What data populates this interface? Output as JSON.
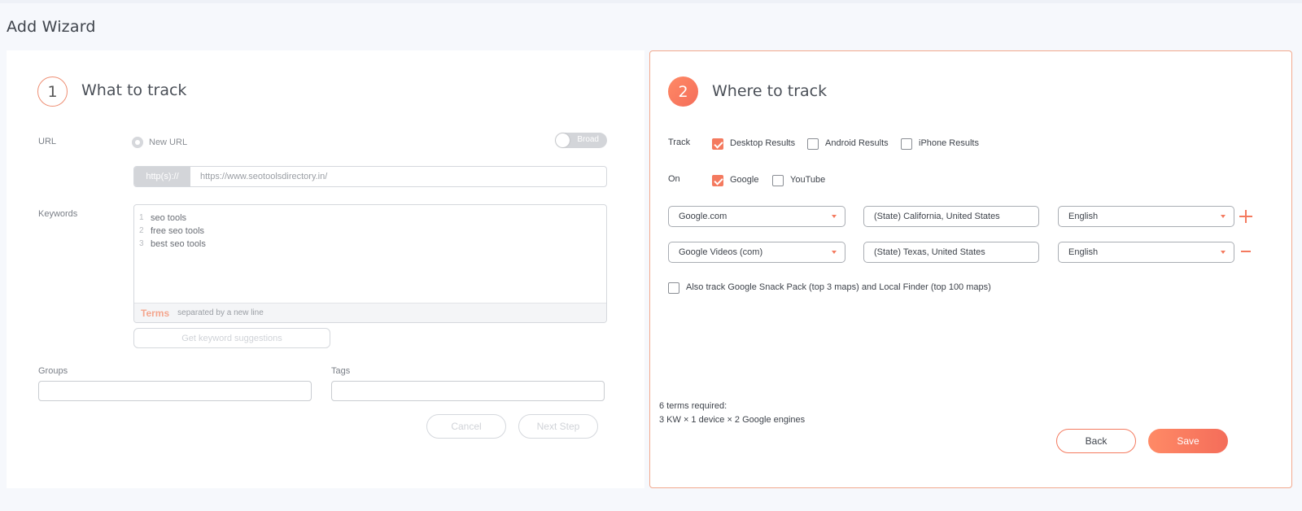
{
  "page": {
    "title": "Add Wizard"
  },
  "step1": {
    "number": "1",
    "title": "What to track",
    "url_label": "URL",
    "new_url_label": "New URL",
    "toggle_label": "Broad",
    "url_prefix": "http(s)://",
    "url_value": "https://www.seotoolsdirectory.in/",
    "keywords_label": "Keywords",
    "keywords": [
      {
        "n": "1",
        "text": "seo tools"
      },
      {
        "n": "2",
        "text": "free seo tools"
      },
      {
        "n": "3",
        "text": "best seo tools"
      }
    ],
    "terms_label": "Terms",
    "terms_hint": "separated by a new line",
    "suggest_button": "Get keyword suggestions",
    "groups_label": "Groups",
    "tags_label": "Tags",
    "cancel_button": "Cancel",
    "next_button": "Next Step"
  },
  "step2": {
    "number": "2",
    "title": "Where to track",
    "track_label": "Track",
    "track_options": [
      {
        "label": "Desktop Results",
        "checked": true
      },
      {
        "label": "Android Results",
        "checked": false
      },
      {
        "label": "iPhone Results",
        "checked": false
      }
    ],
    "on_label": "On",
    "on_options": [
      {
        "label": "Google",
        "checked": true
      },
      {
        "label": "YouTube",
        "checked": false
      }
    ],
    "engines": [
      {
        "engine": "Google.com",
        "location": "(State) California, United States",
        "language": "English",
        "action": "plus-icon"
      },
      {
        "engine": "Google Videos (com)",
        "location": "(State) Texas, United States",
        "language": "English",
        "action": "minus-icon"
      }
    ],
    "snack_pack_label": "Also track Google Snack Pack (top 3 maps) and Local Finder (top 100 maps)",
    "snack_pack_checked": false,
    "summary_line1": "6 terms required:",
    "summary_line2": "3 KW × 1 device × 2 Google engines",
    "back_button": "Back",
    "save_button": "Save"
  },
  "colors": {
    "accent": "#f47a5f",
    "accent_light": "#ff8a66",
    "panel_border": "#f2a98e"
  }
}
